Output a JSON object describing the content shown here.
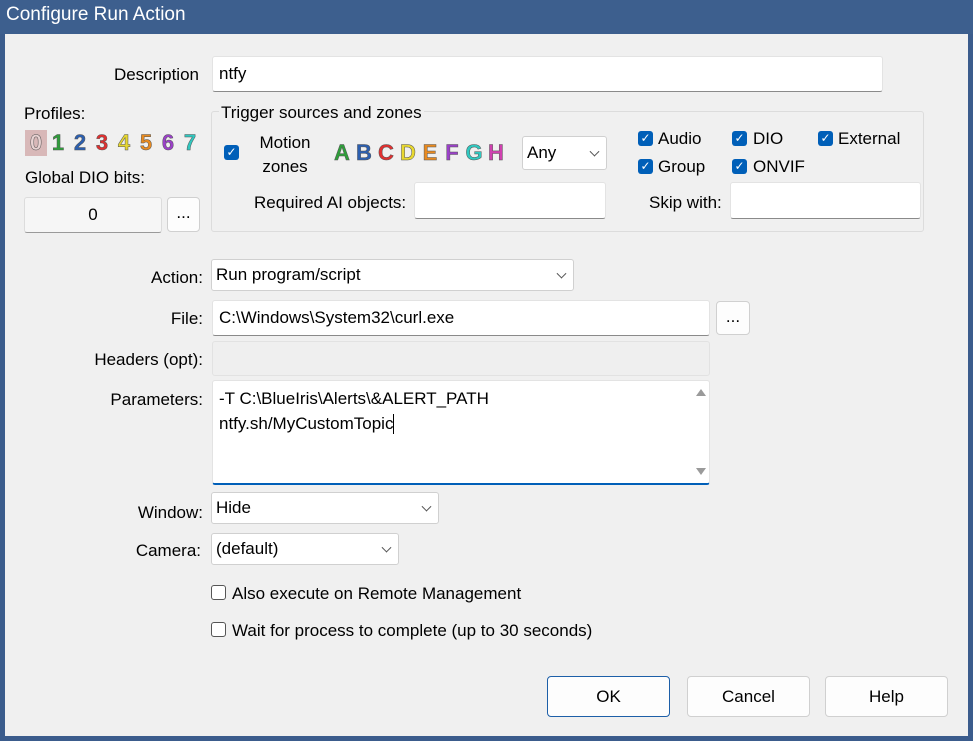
{
  "window": {
    "title": "Configure Run Action"
  },
  "description": {
    "label": "Description",
    "value": "ntfy"
  },
  "profiles": {
    "label": "Profiles:",
    "digits": [
      {
        "text": "0",
        "color": "#e8d2d2"
      },
      {
        "text": "1",
        "color": "#2e9e3a"
      },
      {
        "text": "2",
        "color": "#2b5fb0"
      },
      {
        "text": "3",
        "color": "#e03030"
      },
      {
        "text": "4",
        "color": "#e8d830"
      },
      {
        "text": "5",
        "color": "#e88a20"
      },
      {
        "text": "6",
        "color": "#9a40c8"
      },
      {
        "text": "7",
        "color": "#30c8c0"
      }
    ]
  },
  "global_dio": {
    "label": "Global DIO bits:",
    "value": "0",
    "more_label": "..."
  },
  "trigger": {
    "group_label": "Trigger sources and zones",
    "motion_zones_label_1": "Motion",
    "motion_zones_label_2": "zones",
    "zones": [
      {
        "text": "A",
        "color": "#2e9e3a"
      },
      {
        "text": "B",
        "color": "#2b5fb0"
      },
      {
        "text": "C",
        "color": "#e03030"
      },
      {
        "text": "D",
        "color": "#e8d830"
      },
      {
        "text": "E",
        "color": "#e88a20"
      },
      {
        "text": "F",
        "color": "#9a40c8"
      },
      {
        "text": "G",
        "color": "#30c8c0"
      },
      {
        "text": "H",
        "color": "#d040b0"
      }
    ],
    "zones_select": "Any",
    "audio": "Audio",
    "dio": "DIO",
    "external": "External",
    "group": "Group",
    "onvif": "ONVIF",
    "required_ai_label": "Required AI objects:",
    "required_ai_value": "",
    "skip_with_label": "Skip with:",
    "skip_with_value": ""
  },
  "action": {
    "label": "Action:",
    "value": "Run program/script"
  },
  "file": {
    "label": "File:",
    "value": "C:\\Windows\\System32\\curl.exe",
    "browse_label": "..."
  },
  "headers": {
    "label": "Headers (opt):",
    "value": ""
  },
  "parameters": {
    "label": "Parameters:",
    "line1": "-T C:\\BlueIris\\Alerts\\&ALERT_PATH",
    "line2": "ntfy.sh/MyCustomTopic"
  },
  "window_mode": {
    "label": "Window:",
    "value": "Hide"
  },
  "camera": {
    "label": "Camera:",
    "value": "(default)"
  },
  "options": {
    "remote_mgmt": "Also execute on Remote Management",
    "wait_process": "Wait for process to complete (up to 30 seconds)"
  },
  "buttons": {
    "ok": "OK",
    "cancel": "Cancel",
    "help": "Help"
  },
  "colors": {
    "accent": "#005fb8",
    "titlebar": "#3d5f8e"
  }
}
